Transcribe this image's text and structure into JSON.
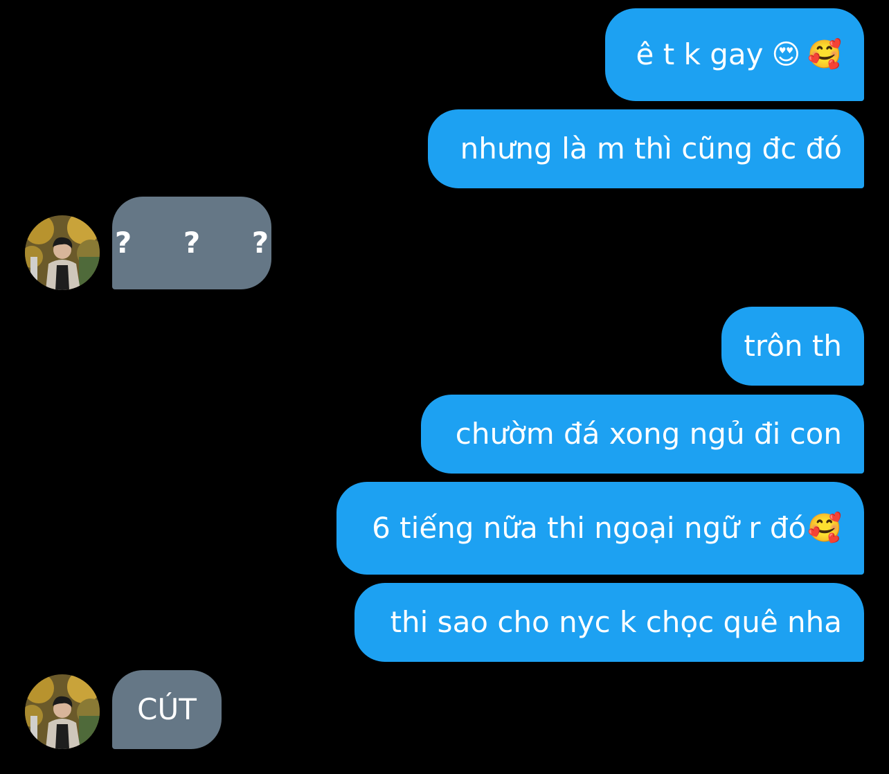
{
  "colors": {
    "background": "#000000",
    "sent_bubble": "#1da1f2",
    "received_bubble": "#657786",
    "text": "#ffffff"
  },
  "messages": [
    {
      "direction": "sent",
      "text": "ê t k gay",
      "emoji": [
        "smiling-face-with-heart-eyes-icon",
        "smiling-face-with-hearts-icon"
      ]
    },
    {
      "direction": "sent",
      "text": "nhưng là m thì cũng đc đó"
    },
    {
      "direction": "received",
      "text": "? ? ?"
    },
    {
      "direction": "sent",
      "text": "trôn th"
    },
    {
      "direction": "sent",
      "text": "chườm đá xong ngủ đi con"
    },
    {
      "direction": "sent",
      "text": "6 tiếng nữa thi ngoại ngữ r đó",
      "emoji": [
        "smiling-face-with-hearts-icon"
      ]
    },
    {
      "direction": "sent",
      "text": "thi sao cho nyc k chọc quê nha"
    },
    {
      "direction": "received",
      "text": "CÚT"
    }
  ]
}
